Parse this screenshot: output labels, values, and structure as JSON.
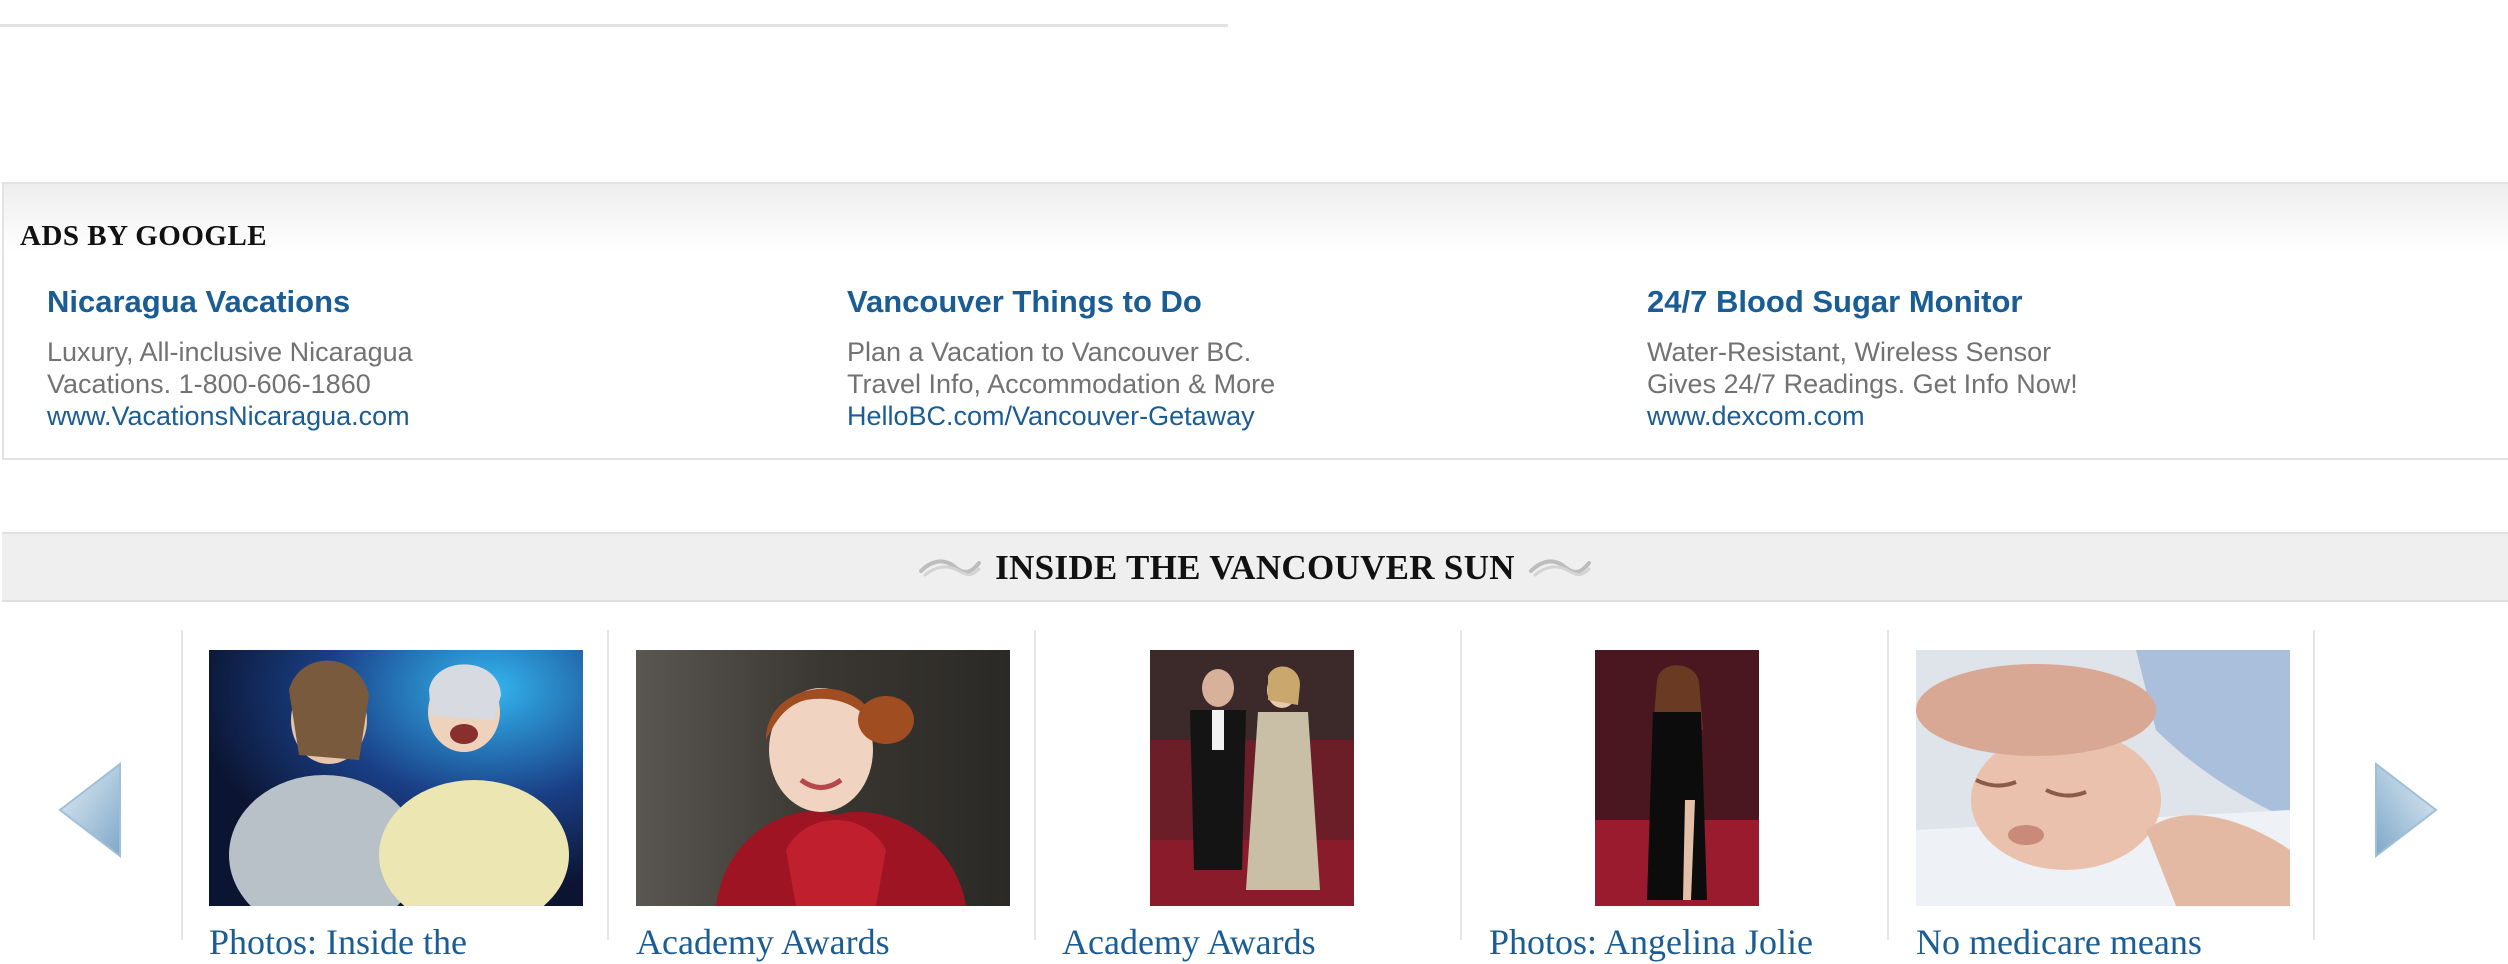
{
  "ads": {
    "heading": "ADS BY GOOGLE",
    "items": [
      {
        "title": "Nicaragua Vacations",
        "desc_line1": "Luxury, All-inclusive Nicaragua",
        "desc_line2": "Vacations. 1-800-606-1860",
        "url": "www.VacationsNicaragua.com"
      },
      {
        "title": "Vancouver Things to Do",
        "desc_line1": "Plan a Vacation to Vancouver BC.",
        "desc_line2": "Travel Info, Accommodation & More",
        "url": "HelloBC.com/Vancouver-Getaway"
      },
      {
        "title": "24/7 Blood Sugar Monitor",
        "desc_line1": "Water-Resistant, Wireless Sensor",
        "desc_line2": "Gives 24/7 Readings. Get Info Now!",
        "url": "www.dexcom.com"
      }
    ]
  },
  "inside": {
    "title": "INSIDE THE VANCOUVER SUN",
    "cards": [
      {
        "title": "Photos: Inside the"
      },
      {
        "title": "Academy Awards"
      },
      {
        "title": "Academy Awards"
      },
      {
        "title": "Photos: Angelina Jolie"
      },
      {
        "title": "No medicare means"
      }
    ]
  },
  "colors": {
    "link": "#1a5c94",
    "ad_text": "#727272",
    "arrow": "#8fb6d4"
  },
  "icons": {
    "prev": "arrow-left-icon",
    "next": "arrow-right-icon",
    "ornament": "swoosh-icon"
  }
}
